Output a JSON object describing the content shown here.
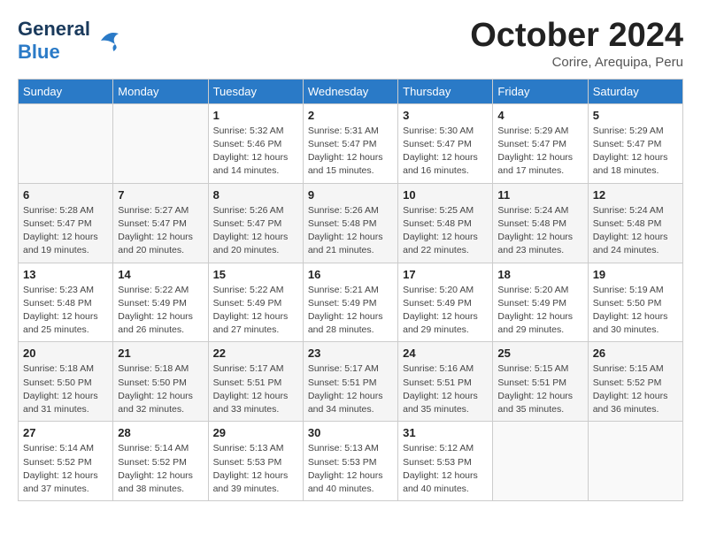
{
  "header": {
    "logo_general": "General",
    "logo_blue": "Blue",
    "month_title": "October 2024",
    "subtitle": "Corire, Arequipa, Peru"
  },
  "weekdays": [
    "Sunday",
    "Monday",
    "Tuesday",
    "Wednesday",
    "Thursday",
    "Friday",
    "Saturday"
  ],
  "weeks": [
    [
      {
        "day": "",
        "info": ""
      },
      {
        "day": "",
        "info": ""
      },
      {
        "day": "1",
        "info": "Sunrise: 5:32 AM\nSunset: 5:46 PM\nDaylight: 12 hours\nand 14 minutes."
      },
      {
        "day": "2",
        "info": "Sunrise: 5:31 AM\nSunset: 5:47 PM\nDaylight: 12 hours\nand 15 minutes."
      },
      {
        "day": "3",
        "info": "Sunrise: 5:30 AM\nSunset: 5:47 PM\nDaylight: 12 hours\nand 16 minutes."
      },
      {
        "day": "4",
        "info": "Sunrise: 5:29 AM\nSunset: 5:47 PM\nDaylight: 12 hours\nand 17 minutes."
      },
      {
        "day": "5",
        "info": "Sunrise: 5:29 AM\nSunset: 5:47 PM\nDaylight: 12 hours\nand 18 minutes."
      }
    ],
    [
      {
        "day": "6",
        "info": "Sunrise: 5:28 AM\nSunset: 5:47 PM\nDaylight: 12 hours\nand 19 minutes."
      },
      {
        "day": "7",
        "info": "Sunrise: 5:27 AM\nSunset: 5:47 PM\nDaylight: 12 hours\nand 20 minutes."
      },
      {
        "day": "8",
        "info": "Sunrise: 5:26 AM\nSunset: 5:47 PM\nDaylight: 12 hours\nand 20 minutes."
      },
      {
        "day": "9",
        "info": "Sunrise: 5:26 AM\nSunset: 5:48 PM\nDaylight: 12 hours\nand 21 minutes."
      },
      {
        "day": "10",
        "info": "Sunrise: 5:25 AM\nSunset: 5:48 PM\nDaylight: 12 hours\nand 22 minutes."
      },
      {
        "day": "11",
        "info": "Sunrise: 5:24 AM\nSunset: 5:48 PM\nDaylight: 12 hours\nand 23 minutes."
      },
      {
        "day": "12",
        "info": "Sunrise: 5:24 AM\nSunset: 5:48 PM\nDaylight: 12 hours\nand 24 minutes."
      }
    ],
    [
      {
        "day": "13",
        "info": "Sunrise: 5:23 AM\nSunset: 5:48 PM\nDaylight: 12 hours\nand 25 minutes."
      },
      {
        "day": "14",
        "info": "Sunrise: 5:22 AM\nSunset: 5:49 PM\nDaylight: 12 hours\nand 26 minutes."
      },
      {
        "day": "15",
        "info": "Sunrise: 5:22 AM\nSunset: 5:49 PM\nDaylight: 12 hours\nand 27 minutes."
      },
      {
        "day": "16",
        "info": "Sunrise: 5:21 AM\nSunset: 5:49 PM\nDaylight: 12 hours\nand 28 minutes."
      },
      {
        "day": "17",
        "info": "Sunrise: 5:20 AM\nSunset: 5:49 PM\nDaylight: 12 hours\nand 29 minutes."
      },
      {
        "day": "18",
        "info": "Sunrise: 5:20 AM\nSunset: 5:49 PM\nDaylight: 12 hours\nand 29 minutes."
      },
      {
        "day": "19",
        "info": "Sunrise: 5:19 AM\nSunset: 5:50 PM\nDaylight: 12 hours\nand 30 minutes."
      }
    ],
    [
      {
        "day": "20",
        "info": "Sunrise: 5:18 AM\nSunset: 5:50 PM\nDaylight: 12 hours\nand 31 minutes."
      },
      {
        "day": "21",
        "info": "Sunrise: 5:18 AM\nSunset: 5:50 PM\nDaylight: 12 hours\nand 32 minutes."
      },
      {
        "day": "22",
        "info": "Sunrise: 5:17 AM\nSunset: 5:51 PM\nDaylight: 12 hours\nand 33 minutes."
      },
      {
        "day": "23",
        "info": "Sunrise: 5:17 AM\nSunset: 5:51 PM\nDaylight: 12 hours\nand 34 minutes."
      },
      {
        "day": "24",
        "info": "Sunrise: 5:16 AM\nSunset: 5:51 PM\nDaylight: 12 hours\nand 35 minutes."
      },
      {
        "day": "25",
        "info": "Sunrise: 5:15 AM\nSunset: 5:51 PM\nDaylight: 12 hours\nand 35 minutes."
      },
      {
        "day": "26",
        "info": "Sunrise: 5:15 AM\nSunset: 5:52 PM\nDaylight: 12 hours\nand 36 minutes."
      }
    ],
    [
      {
        "day": "27",
        "info": "Sunrise: 5:14 AM\nSunset: 5:52 PM\nDaylight: 12 hours\nand 37 minutes."
      },
      {
        "day": "28",
        "info": "Sunrise: 5:14 AM\nSunset: 5:52 PM\nDaylight: 12 hours\nand 38 minutes."
      },
      {
        "day": "29",
        "info": "Sunrise: 5:13 AM\nSunset: 5:53 PM\nDaylight: 12 hours\nand 39 minutes."
      },
      {
        "day": "30",
        "info": "Sunrise: 5:13 AM\nSunset: 5:53 PM\nDaylight: 12 hours\nand 40 minutes."
      },
      {
        "day": "31",
        "info": "Sunrise: 5:12 AM\nSunset: 5:53 PM\nDaylight: 12 hours\nand 40 minutes."
      },
      {
        "day": "",
        "info": ""
      },
      {
        "day": "",
        "info": ""
      }
    ]
  ]
}
